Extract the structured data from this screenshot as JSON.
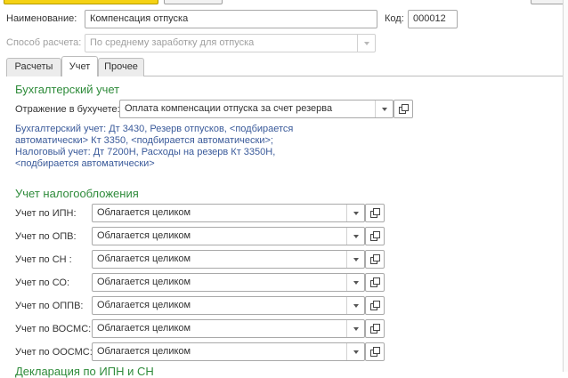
{
  "form": {
    "name_label": "Наименование:",
    "name_value": "Компенсация отпуска",
    "code_label": "Код:",
    "code_value": "000012",
    "calc_method_label": "Способ расчета:",
    "calc_method_value": "По среднему заработку для отпуска"
  },
  "tabs": [
    {
      "label": "Расчеты",
      "active": false
    },
    {
      "label": "Учет",
      "active": true
    },
    {
      "label": "Прочее",
      "active": false
    }
  ],
  "accounting": {
    "title": "Бухгалтерский учет",
    "reflection_label": "Отражение в бухучете:",
    "reflection_value": "Оплата компенсации отпуска за счет резерва",
    "info_lines": [
      "Бухгалтерский учет: Дт 3430, Резерв отпусков, <подбирается",
      "автоматически> Кт 3350, <подбирается автоматически>;",
      "Налоговый учет: Дт 7200Н, Расходы на резерв Кт 3350Н,",
      "<подбирается автоматически>"
    ]
  },
  "taxation": {
    "title": "Учет налогообложения",
    "rows": [
      {
        "label": "Учет по ИПН:",
        "value": "Облагается целиком"
      },
      {
        "label": "Учет по ОПВ:",
        "value": "Облагается целиком"
      },
      {
        "label": "Учет по СН :",
        "value": "Облагается целиком"
      },
      {
        "label": "Учет по СО:",
        "value": "Облагается целиком"
      },
      {
        "label": "Учет по ОППВ:",
        "value": "Облагается целиком"
      },
      {
        "label": "Учет по ВОСМС:",
        "value": "Облагается целиком"
      },
      {
        "label": "Учет по ООСМС:",
        "value": "Облагается целиком"
      }
    ]
  },
  "next_section": {
    "title": "Декларация по ИПН и СН"
  },
  "colors": {
    "section_title": "#2e8b3a",
    "info_text": "#3a5a9a",
    "primary_button": "#f5d214"
  }
}
